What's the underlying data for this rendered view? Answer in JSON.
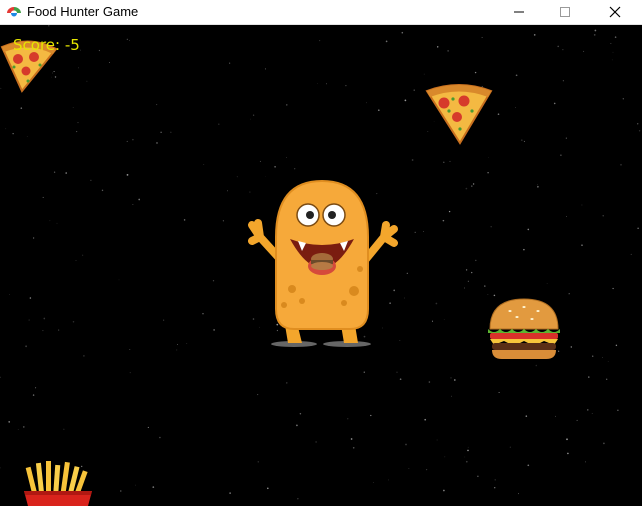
{
  "window": {
    "title": "Food Hunter Game",
    "icon": "palette-icon"
  },
  "controls": {
    "minimize": "minimize-icon",
    "maximize": "maximize-icon",
    "close": "close-icon"
  },
  "game": {
    "score_text": "Score: -5",
    "score_color": "#e6e600",
    "background": "#000000",
    "player": "orange-monster",
    "foods": [
      "pizza-slice",
      "pizza-slice",
      "hamburger",
      "french-fries"
    ]
  }
}
